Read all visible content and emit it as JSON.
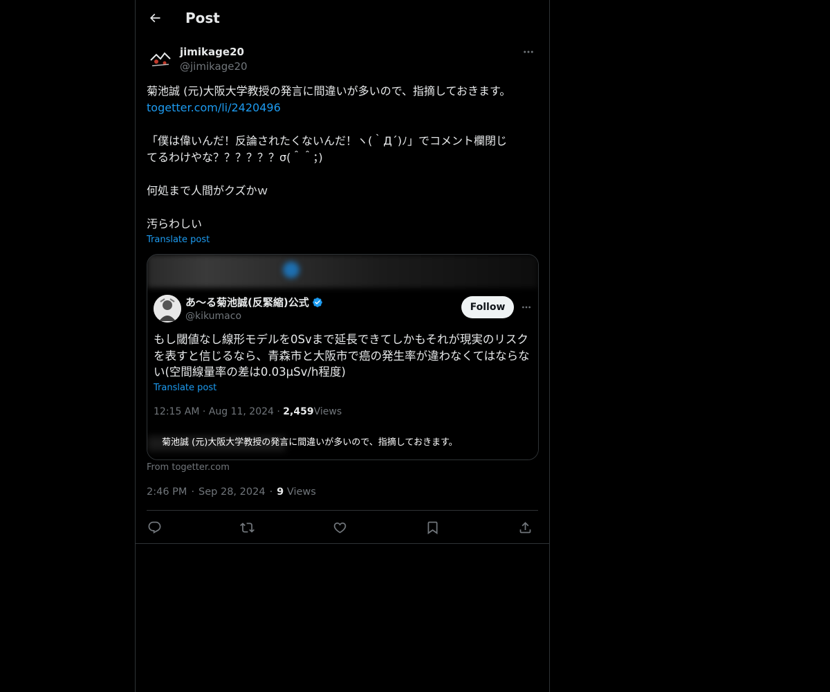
{
  "header": {
    "title": "Post",
    "back_icon": "arrow-left-icon"
  },
  "author": {
    "name": "jimikage20",
    "handle": "@jimikage20",
    "more_icon": "more-horizontal-icon"
  },
  "post": {
    "line1": "菊池誠 (元)大阪大学教授の発言に間違いが多いので、指摘しておきます。",
    "link": "togetter.com/li/2420496",
    "line2": "「僕は偉いんだ！反論されたくないんだ！ヽ(｀Д´)ﾉ」でコメント欄閉じ",
    "line3": "てるわけやな？？？？？？σ(＾＾；)",
    "line4": "何処まで人間がクズかｗ",
    "line5": "汚らわしい",
    "translate_label": "Translate post"
  },
  "card": {
    "embedded_name": "あ〜る菊池誠(反緊縮)公式",
    "embedded_handle": "@kikumaco",
    "follow_label": "Follow",
    "text_line1": "もし閾値なし線形モデルを0Svまで延長できてしかもそれが現実のリスク",
    "text_line2": "を表すと信じるなら、青森市と大阪市で癌の発生率が違わなくてはならな",
    "text_line3": "い(空間線量率の差は0.03μSv/h程度)",
    "translate_label": "Translate post",
    "meta_time": "12:15 AM · Aug 11, 2024 · ",
    "meta_views_count": "2,459",
    "meta_views_label": "Views",
    "caption": "菊池誠 (元)大阪大学教授の発言に間違いが多いので、指摘しておきます。",
    "verified_color": "#1d9bf0"
  },
  "source": {
    "label": "From togetter.com"
  },
  "meta": {
    "time": "2:46 PM",
    "sep1": "·",
    "date": "Sep 28, 2024",
    "sep2": "·",
    "views_count": "9",
    "views_label": "Views"
  },
  "actions": {
    "reply_icon": "reply-icon",
    "repost_icon": "repost-icon",
    "like_icon": "heart-icon",
    "bookmark_icon": "bookmark-icon",
    "share_icon": "share-icon"
  },
  "colors": {
    "background": "#000000",
    "text": "#e7e9ea",
    "secondary": "#71767b",
    "link": "#1d9bf0",
    "border": "#2f3336"
  }
}
